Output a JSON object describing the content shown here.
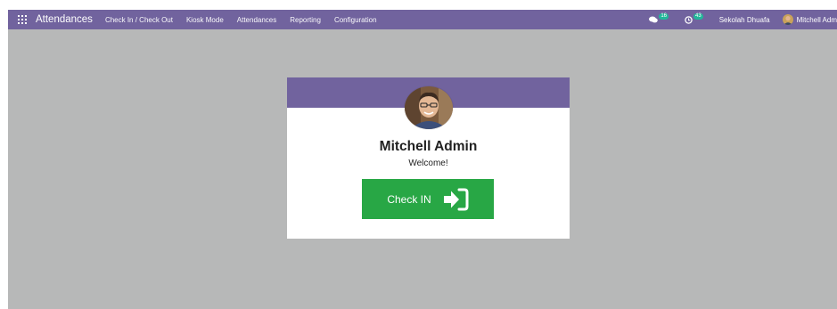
{
  "navbar": {
    "app_title": "Attendances",
    "menu": [
      "Check In / Check Out",
      "Kiosk Mode",
      "Attendances",
      "Reporting",
      "Configuration"
    ],
    "messages_count": "16",
    "activities_count": "43",
    "company": "Sekolah Dhuafa",
    "user": "Mitchell Adm"
  },
  "kiosk": {
    "employee_name": "Mitchell Admin",
    "greeting": "Welcome!",
    "check_in_label": "Check IN"
  },
  "icons": {
    "apps": "grid-icon",
    "messages": "chat-icon",
    "activities": "clock-icon",
    "check_in": "sign-in-icon"
  },
  "colors": {
    "navbar": "#71639e",
    "background": "#b7b8b8",
    "check_in_button": "#28a745",
    "badge": "#21b799"
  }
}
